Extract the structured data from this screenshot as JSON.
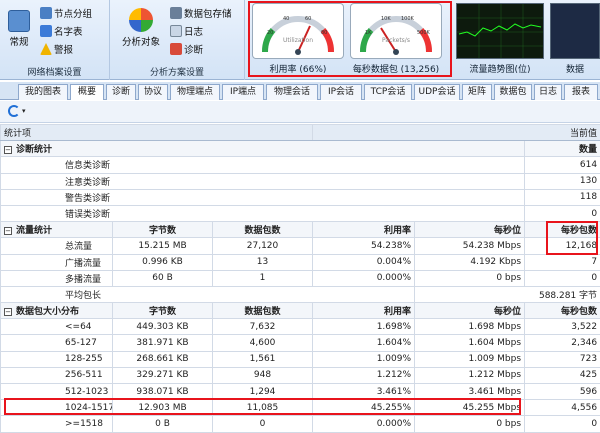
{
  "ribbon": {
    "groups": [
      {
        "label": "网络档案设置",
        "big": "常规",
        "items": [
          "节点分组",
          "名字表",
          "警报"
        ]
      },
      {
        "label": "分析方案设置",
        "big": "分析对象",
        "items": [
          "数据包存储",
          "日志",
          "诊断"
        ]
      }
    ],
    "gauges": [
      {
        "inner": "Utilization",
        "caption": "利用率 (66%)",
        "ticks": [
          "0",
          "20",
          "40",
          "60",
          "80",
          "100"
        ]
      },
      {
        "inner": "Packets/s",
        "caption": "每秒数据包 (13,256)",
        "ticks": [
          "0",
          "1K",
          "10K",
          "100K",
          "500K",
          "1M"
        ]
      }
    ],
    "trend_caption": "流量趋势图(位)",
    "extra_caption": "数据"
  },
  "tabs": [
    "我的图表",
    "概要",
    "诊断",
    "协议",
    "物理端点",
    "IP端点",
    "物理会话",
    "IP会话",
    "TCP会话",
    "UDP会话",
    "矩阵",
    "数据包",
    "日志",
    "报表"
  ],
  "toolbar": {
    "refresh_icon": "refresh-icon"
  },
  "table": {
    "header": {
      "item": "统计项",
      "current": "当前值"
    },
    "diag": {
      "title": "诊断统计",
      "col": "数量",
      "rows": [
        [
          "信息类诊断",
          "614"
        ],
        [
          "注意类诊断",
          "130"
        ],
        [
          "警告类诊断",
          "118"
        ],
        [
          "错误类诊断",
          "0"
        ]
      ]
    },
    "flow": {
      "title": "流量统计",
      "cols": [
        "字节数",
        "数据包数",
        "利用率",
        "每秒位",
        "每秒包数"
      ],
      "rows": [
        [
          "总流量",
          "15.215 MB",
          "27,120",
          "54.238%",
          "54.238 Mbps",
          "12,168"
        ],
        [
          "广播流量",
          "0.996 KB",
          "13",
          "0.004%",
          "4.192 Kbps",
          "7"
        ],
        [
          "多播流量",
          "60 B",
          "1",
          "0.000%",
          "0 bps",
          "0"
        ]
      ],
      "avg": {
        "label": "平均包长",
        "value": "588.281 字节"
      }
    },
    "size": {
      "title": "数据包大小分布",
      "cols": [
        "字节数",
        "数据包数",
        "利用率",
        "每秒位",
        "每秒包数"
      ],
      "rows": [
        [
          "<=64",
          "449.303 KB",
          "7,632",
          "1.698%",
          "1.698 Mbps",
          "3,522"
        ],
        [
          "65-127",
          "381.971 KB",
          "4,600",
          "1.604%",
          "1.604 Mbps",
          "2,346"
        ],
        [
          "128-255",
          "268.661 KB",
          "1,561",
          "1.009%",
          "1.009 Mbps",
          "723"
        ],
        [
          "256-511",
          "329.271 KB",
          "948",
          "1.212%",
          "1.212 Mbps",
          "425"
        ],
        [
          "512-1023",
          "938.071 KB",
          "1,294",
          "3.461%",
          "3.461 Mbps",
          "596"
        ],
        [
          "1024-1517",
          "12.903 MB",
          "11,085",
          "45.255%",
          "45.255 Mbps",
          "4,556"
        ],
        [
          ">=1518",
          "0 B",
          "0",
          "0.000%",
          "0 bps",
          "0"
        ]
      ]
    }
  }
}
